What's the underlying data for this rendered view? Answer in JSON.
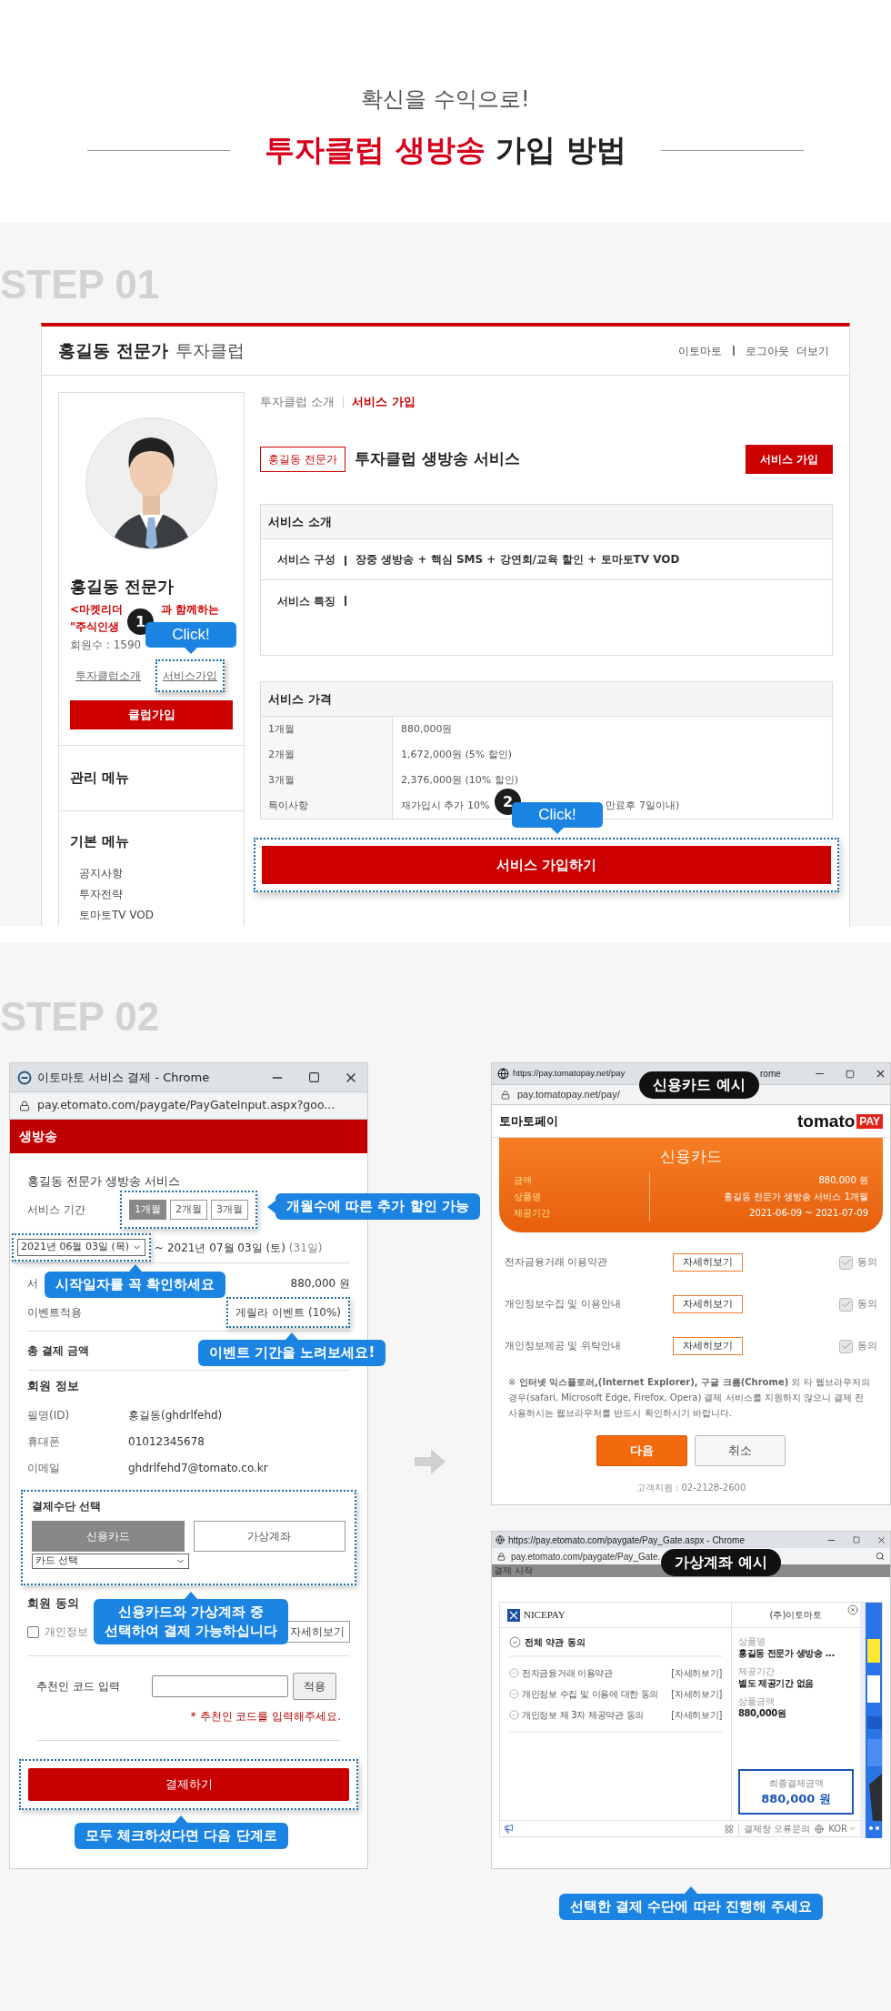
{
  "intro": {
    "subtitle": "확신을 수익으로!",
    "title_highlight": "투자클럽 생방송",
    "title_rest": "가입 방법"
  },
  "step1": {
    "step_label": "STEP 01",
    "site": {
      "expert": "홍길동 전문가",
      "club": "투자클럽",
      "top_links": [
        {
          "label": "이토마토"
        },
        {
          "label": "로그아웃"
        },
        {
          "label": "더보기"
        }
      ]
    },
    "profile": {
      "name": "홍길동 전문가",
      "slogan_start": "<마켓리더",
      "slogan_end": "과 함께하는",
      "slogan_line2": "\"주식인생",
      "members": "회원수 : 1590",
      "links": [
        {
          "label": "투자클럽소개",
          "highlighted": false
        },
        {
          "label": "서비스가입",
          "highlighted": true
        }
      ],
      "join_button": "클럽가입"
    },
    "menus": [
      {
        "title": "관리 메뉴"
      },
      {
        "title": "기본 메뉴",
        "items": [
          "공지사항",
          "투자전략",
          "토마토TV VOD"
        ]
      }
    ],
    "content": {
      "tabs": [
        {
          "label": "투자클럽 소개",
          "selected": false
        },
        {
          "label": "서비스 가입",
          "selected": true
        }
      ],
      "expert_tag": "홍길동 전문가",
      "service_title": "투자클럽 생방송 서비스",
      "join_button": "서비스 가입",
      "intro": {
        "title": "서비스 소개",
        "rows": [
          {
            "label": "서비스 구성",
            "value": "장중 생방송 + 핵심 SMS + 강연회/교육 할인 + 토마토TV VOD"
          },
          {
            "label": "서비스 특징"
          }
        ]
      },
      "price": {
        "title": "서비스 가격",
        "rows": [
          {
            "period": "1개월",
            "price": "880,000원"
          },
          {
            "period": "2개월",
            "price": "1,672,000원 (5% 할인)"
          },
          {
            "period": "3개월",
            "price": "2,376,000원 (10% 할인)"
          },
          {
            "period": "특이사항",
            "price": "재가입시 추가 10%",
            "price_tail": "만료후 7일이내)"
          }
        ]
      },
      "submit_button": "서비스 가입하기"
    },
    "callouts": [
      {
        "number": "1",
        "text": "Click!"
      },
      {
        "number": "2",
        "text": "Click!"
      }
    ]
  },
  "step2": {
    "step_label": "STEP 02",
    "payment_window": {
      "title": "이토마토 서비스 결제 - Chrome",
      "url": "pay.etomato.com/paygate/PayGateInput.aspx?goo...",
      "banner": "생방송",
      "service_name": "홍길동 전문가 생방송 서비스",
      "period_label": "서비스 기간",
      "periods": [
        {
          "label": "1개월",
          "selected": true
        },
        {
          "label": "2개월",
          "selected": false
        },
        {
          "label": "3개월",
          "selected": false
        }
      ],
      "start_date": "2021년 06월 03일 (목)",
      "end_date": "~ 2021년 07월 03일 (토)",
      "days": "(31일)",
      "amount_label": "서",
      "amount": "880,000 원",
      "event_label": "이벤트적용",
      "event": "게릴라 이벤트 (10%)",
      "total_label": "총 결제 금액",
      "member_title": "회원 정보",
      "member_rows": [
        {
          "label": "필명(ID)",
          "value": "홍길동(ghdrlfehd)"
        },
        {
          "label": "휴대폰",
          "value": "01012345678"
        },
        {
          "label": "이메일",
          "value": "ghdrlfehd7@tomato.co.kr"
        }
      ],
      "method_title": "결제수단 선택",
      "methods": [
        {
          "label": "신용카드",
          "selected": true
        },
        {
          "label": "가상계좌",
          "selected": false
        }
      ],
      "card_select": "카드 선택",
      "agree_title": "회원 동의",
      "agree": {
        "label": "개인정보",
        "checked": false,
        "button": "자세히보기"
      },
      "referral_label": "추천인 코드 입력",
      "referral_button": "적용",
      "referral_note": "* 추천인 코드를 입력해주세요.",
      "pay_button": "결제하기",
      "tips": [
        "개월수에 따른 추가 할인 가능",
        "시작일자를 꼭 확인하세요",
        "이벤트 기간을 노려보세요!",
        "신용카드와 가상계좌 중\n선택하여 결제 가능하십니다",
        "모두 체크하셨다면 다음 단계로"
      ]
    },
    "card_example": {
      "label": "신용카드 예시",
      "title_url": "https://pay.tomatopay.net/pay",
      "title_tail": "rome",
      "url": "pay.tomatopay.net/pay/",
      "brand": "토마토페이",
      "logo_word": "tomato",
      "logo_badge": "PAY",
      "card_title": "신용카드",
      "summary": [
        {
          "label": "금액",
          "value": "880,000 원"
        },
        {
          "label": "상품명",
          "value": "홍길동 전문가 생방송 서비스 1개월"
        },
        {
          "label": "제공기간",
          "value": "2021-06-09 ~ 2021-07-09"
        }
      ],
      "terms": [
        {
          "label": "전자금융거래 이용약관",
          "button": "자세히보기",
          "agree": "동의",
          "checked": true
        },
        {
          "label": "개인정보수집 및 이용안내",
          "button": "자세히보기",
          "agree": "동의",
          "checked": true
        },
        {
          "label": "개인정보제공 및 위탁안내",
          "button": "자세히보기",
          "agree": "동의",
          "checked": true
        }
      ],
      "notice": "※ **인터넷 익스플로러,(Internet Explorer), 구글 크롬(Chrome)** 외 타 웹브라우저의 경우(safari, Microsoft Edge, Firefox, Opera) 결제 서비스를 지원하지 않으니 결제 전 사용하시는 웹브라우저를 반드시 확인하시기 바랍니다.",
      "next_button": "다음",
      "cancel_button": "취소",
      "support": "고객지원 : 02-2128-2600"
    },
    "account_example": {
      "label": "가상계좌 예시",
      "title": "https://pay.etomato.com/paygate/Pay_Gate.aspx - Chrome",
      "url": "pay.etomato.com/paygate/Pay_Gate.",
      "status": "결제 시작",
      "provider": "NICEPAY",
      "merchant": "(주)이토마토",
      "all_agree": "전체 약관 동의",
      "terms": [
        {
          "label": "전자금융거래 이용약관",
          "link": "[자세히보기]"
        },
        {
          "label": "개인정보 수집 및 이용에 대한 동의",
          "link": "[자세히보기]"
        },
        {
          "label": "개인정보 제 3자 제공약관 동의",
          "link": "[자세히보기]"
        }
      ],
      "details": [
        {
          "label": "상품명",
          "value": "홍길동 전문가 생방송 ..."
        },
        {
          "label": "제공기간",
          "value": "별도 제공기간 없음"
        },
        {
          "label": "상품금액",
          "value": "880,000원"
        }
      ],
      "final_label": "최종결제금액",
      "final_amount": "880,000 원",
      "error_link": "결제창 오류문의",
      "language": "KOR"
    },
    "final_tip": "선택한 결제 수단에 따라 진행해 주세요"
  }
}
